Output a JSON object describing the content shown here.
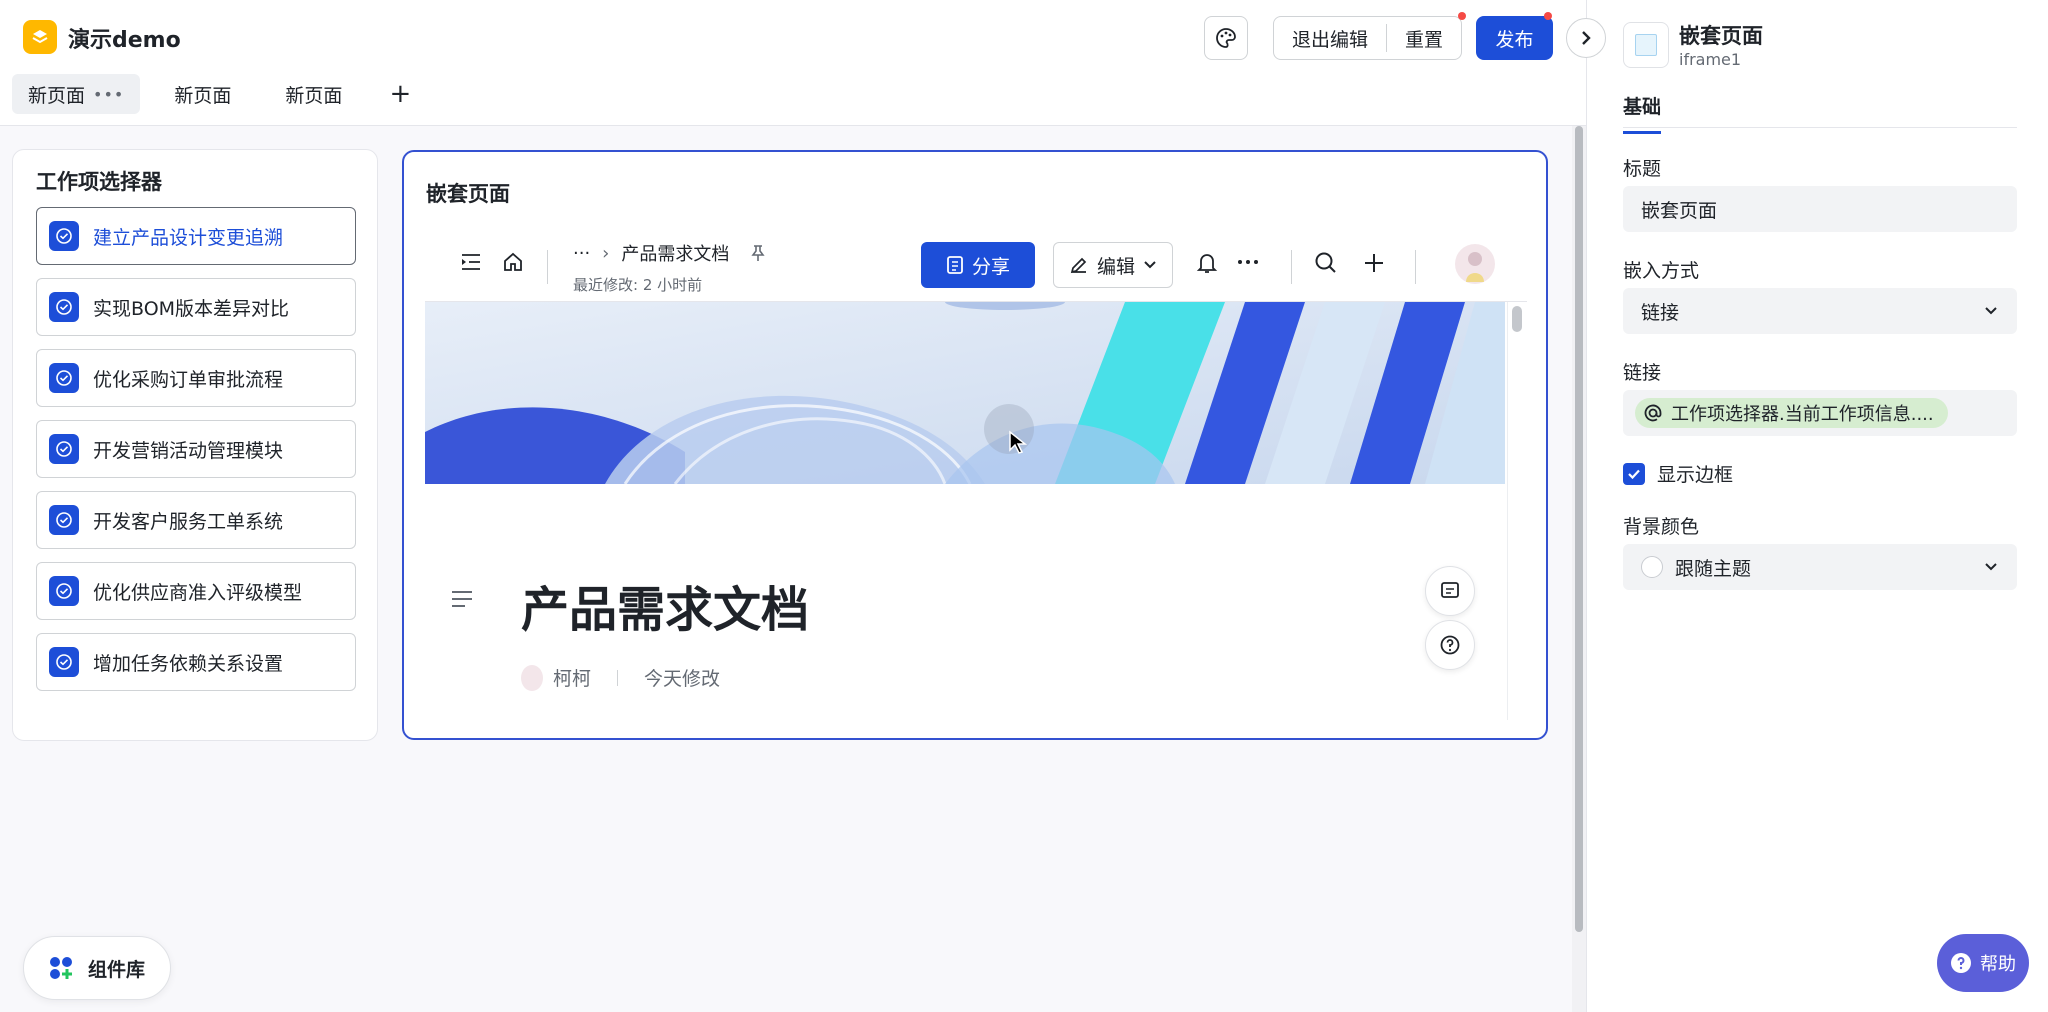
{
  "app": {
    "title": "演示demo"
  },
  "tabs": [
    {
      "label": "新页面",
      "active": true,
      "more": "•••"
    },
    {
      "label": "新页面"
    },
    {
      "label": "新页面"
    }
  ],
  "toolbar": {
    "exit_edit": "退出编辑",
    "reset": "重置",
    "publish": "发布"
  },
  "selector": {
    "title": "工作项选择器",
    "items": [
      {
        "label": "建立产品设计变更追溯",
        "active": true
      },
      {
        "label": "实现BOM版本差异对比"
      },
      {
        "label": "优化采购订单审批流程"
      },
      {
        "label": "开发营销活动管理模块"
      },
      {
        "label": "开发客户服务工单系统"
      },
      {
        "label": "优化供应商准入评级模型"
      },
      {
        "label": "增加任务依赖关系设置"
      }
    ]
  },
  "embed": {
    "title": "嵌套页面",
    "doc": {
      "breadcrumb_more": "···",
      "breadcrumb_current": "产品需求文档",
      "modified": "最近修改: 2 小时前",
      "share": "分享",
      "edit": "编辑",
      "title": "产品需求文档",
      "author": "柯柯",
      "updated": "今天修改"
    }
  },
  "component_library": {
    "label": "组件库"
  },
  "props": {
    "title": "嵌套页面",
    "subtitle": "iframe1",
    "tab": "基础",
    "title_label": "标题",
    "title_value": "嵌套页面",
    "embed_mode_label": "嵌入方式",
    "embed_mode_value": "链接",
    "link_label": "链接",
    "link_value": "工作项选择器.当前工作项信息....",
    "show_border_label": "显示边框",
    "show_border": true,
    "bg_color_label": "背景颜色",
    "bg_color_value": "跟随主题"
  },
  "help": {
    "label": "帮助"
  },
  "colors": {
    "primary": "#1d4ed8",
    "selection_border": "#3451d1",
    "logo": "#ffb800",
    "help": "#5b5fd9",
    "link_chip": "#d6edd0"
  }
}
